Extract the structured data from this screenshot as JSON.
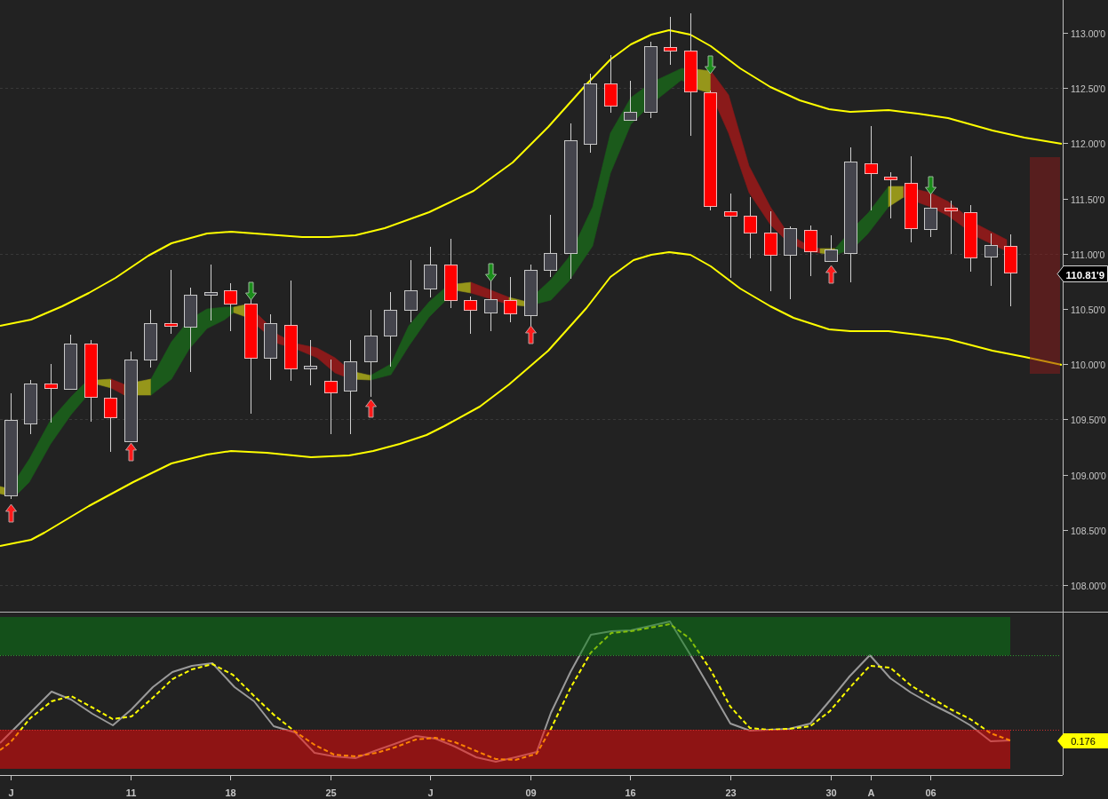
{
  "price_chart": {
    "axis_labels": [
      "113.00'0",
      "112.50'0",
      "112.00'0",
      "111.50'0",
      "111.00'0",
      "110.50'0",
      "110.00'0",
      "109.50'0",
      "109.00'0",
      "108.50'0",
      "108.00'0"
    ],
    "last_price_tag": "110.81'9"
  },
  "oscillator": {
    "value_tag": "0.176"
  },
  "date_axis": [
    "J",
    "11",
    "18",
    "25",
    "J",
    "09",
    "16",
    "23",
    "30",
    "A",
    "06"
  ]
}
